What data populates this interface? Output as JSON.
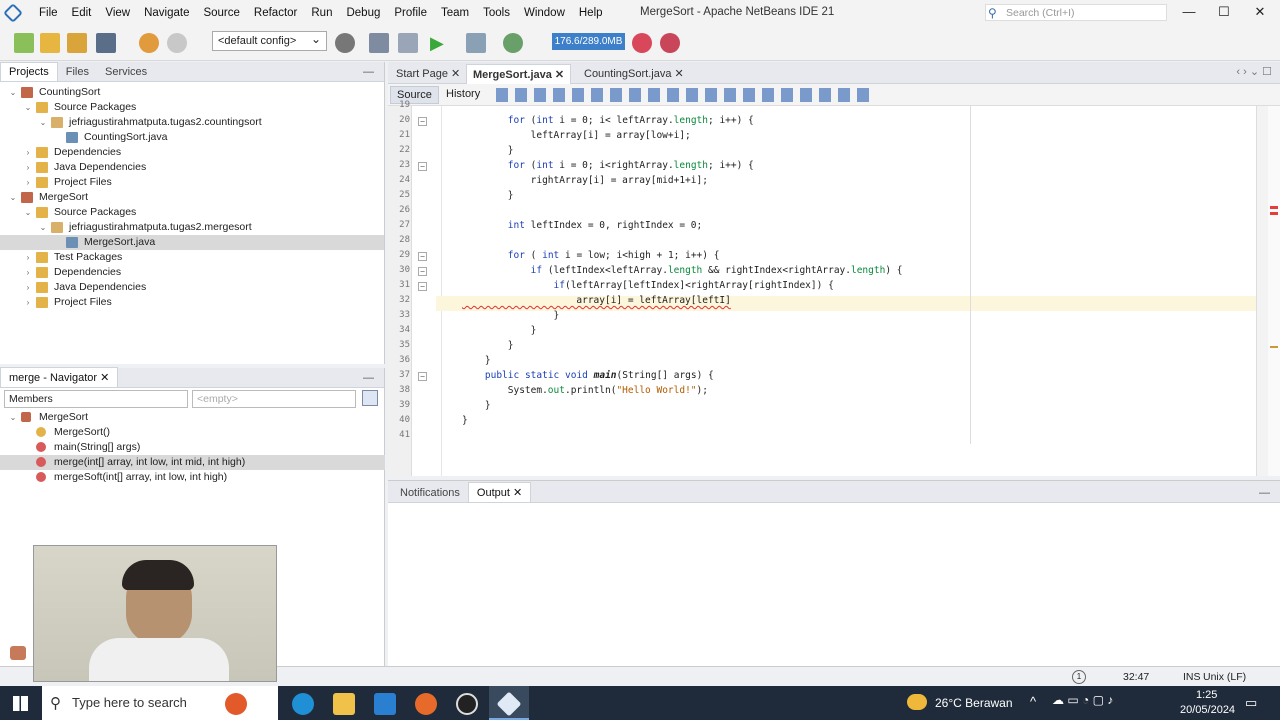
{
  "app": {
    "title": "MergeSort - Apache NetBeans IDE 21",
    "search_placeholder": "Search (Ctrl+I)"
  },
  "menu": [
    "File",
    "Edit",
    "View",
    "Navigate",
    "Source",
    "Refactor",
    "Run",
    "Debug",
    "Profile",
    "Team",
    "Tools",
    "Window",
    "Help"
  ],
  "toolbar": {
    "config": "<default config>",
    "memory": "176.6/289.0MB"
  },
  "projects": {
    "tabs": [
      "Projects",
      "Files",
      "Services"
    ],
    "tree": [
      {
        "label": "CountingSort",
        "level": 0,
        "icon": "coffee-cup-icon"
      },
      {
        "label": "Source Packages",
        "level": 1,
        "icon": "folder-icon"
      },
      {
        "label": "jefriagustirahmatputa.tugas2.countingsort",
        "level": 2,
        "icon": "package-icon"
      },
      {
        "label": "CountingSort.java",
        "level": 3,
        "icon": "java-file-icon"
      },
      {
        "label": "Dependencies",
        "level": 1,
        "icon": "folder-icon"
      },
      {
        "label": "Java Dependencies",
        "level": 1,
        "icon": "folder-icon"
      },
      {
        "label": "Project Files",
        "level": 1,
        "icon": "folder-icon"
      },
      {
        "label": "MergeSort",
        "level": 0,
        "icon": "coffee-cup-icon"
      },
      {
        "label": "Source Packages",
        "level": 1,
        "icon": "folder-icon"
      },
      {
        "label": "jefriagustirahmatputa.tugas2.mergesort",
        "level": 2,
        "icon": "package-icon"
      },
      {
        "label": "MergeSort.java",
        "level": 3,
        "icon": "java-file-icon",
        "selected": true
      },
      {
        "label": "Test Packages",
        "level": 1,
        "icon": "folder-icon"
      },
      {
        "label": "Dependencies",
        "level": 1,
        "icon": "folder-icon"
      },
      {
        "label": "Java Dependencies",
        "level": 1,
        "icon": "folder-icon"
      },
      {
        "label": "Project Files",
        "level": 1,
        "icon": "folder-icon"
      }
    ]
  },
  "navigator": {
    "title": "merge - Navigator",
    "combo1": "Members",
    "combo2": "<empty>",
    "items": [
      {
        "label": "MergeSort",
        "level": 0
      },
      {
        "label": "MergeSort()",
        "level": 1
      },
      {
        "label": "main(String[] args)",
        "level": 1
      },
      {
        "label": "merge(int[] array, int low, int mid, int high)",
        "level": 1,
        "selected": true
      },
      {
        "label": "mergeSoft(int[] array, int low, int high)",
        "level": 1
      }
    ]
  },
  "editor": {
    "tabs": [
      "Start Page",
      "MergeSort.java",
      "CountingSort.java"
    ],
    "source_label": "Source",
    "history_label": "History",
    "lines": [
      {
        "n": "19",
        "t": ""
      },
      {
        "n": "20",
        "t": "        for (int i = 0; i< leftArray.length; i++) {"
      },
      {
        "n": "21",
        "t": "            leftArray[i] = array[low+i];"
      },
      {
        "n": "22",
        "t": "        }"
      },
      {
        "n": "23",
        "t": "        for (int i = 0; i<rightArray.length; i++) {"
      },
      {
        "n": "24",
        "t": "            rightArray[i] = array[mid+1+i];"
      },
      {
        "n": "25",
        "t": "        }"
      },
      {
        "n": "26",
        "t": ""
      },
      {
        "n": "27",
        "t": "        int leftIndex = 0, rightIndex = 0;"
      },
      {
        "n": "28",
        "t": ""
      },
      {
        "n": "29",
        "t": "        for ( int i = low; i<high + 1; i++) {"
      },
      {
        "n": "30",
        "t": "            if (leftIndex<leftArray.length && rightIndex<rightArray.length) {"
      },
      {
        "n": "31",
        "t": "                if(leftArray[leftIndex]<rightArray[rightIndex]) {"
      },
      {
        "n": "32",
        "t": "                    array[i] = leftArray[leftI]"
      },
      {
        "n": "33",
        "t": "                }"
      },
      {
        "n": "34",
        "t": "            }"
      },
      {
        "n": "35",
        "t": "        }"
      },
      {
        "n": "36",
        "t": "    }"
      },
      {
        "n": "37",
        "t": "    public static void main(String[] args) {"
      },
      {
        "n": "38",
        "t": "        System.out.println(\"Hello World!\");"
      },
      {
        "n": "39",
        "t": "    }"
      },
      {
        "n": "40",
        "t": "}"
      },
      {
        "n": "41",
        "t": ""
      }
    ]
  },
  "output": {
    "tabs": [
      "Notifications",
      "Output"
    ]
  },
  "status": {
    "notif_count": "1",
    "position": "32:47",
    "mode": "INS",
    "line_ending": "Unix (LF)"
  },
  "taskbar": {
    "search": "Type here to search",
    "weather": "26°C  Berawan",
    "time": "1:25",
    "date": "20/05/2024"
  }
}
